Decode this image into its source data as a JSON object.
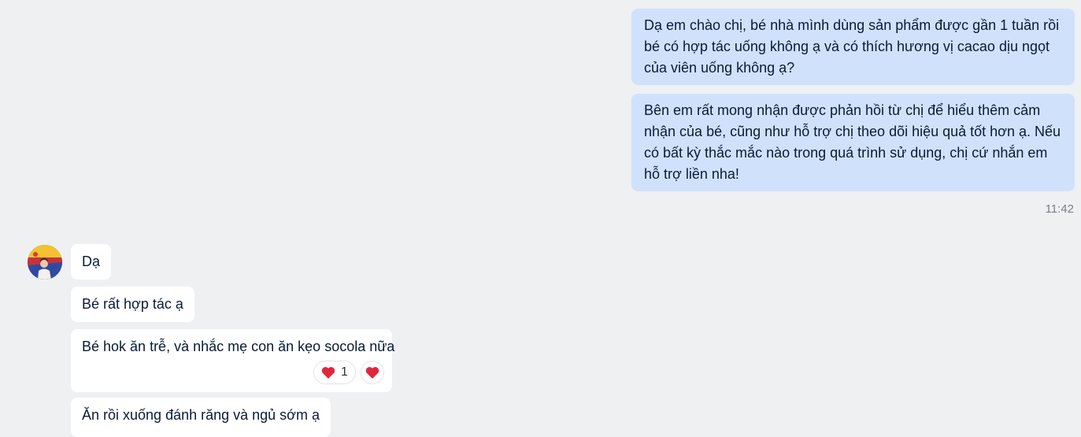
{
  "outgoing": [
    {
      "text": "Dạ em chào chị, bé nhà mình dùng sản phẩm được gần 1 tuần rồi bé có hợp tác uống không ạ và có thích hương vị cacao dịu ngọt của viên uống không ạ?"
    },
    {
      "text": "Bên em rất mong nhận được phản hồi từ chị để hiểu thêm cảm nhận của bé, cũng như hỗ trợ chị theo dõi hiệu quả tốt hơn ạ. Nếu có bất kỳ thắc mắc nào trong quá trình sử dụng, chị cứ nhắn em hỗ trợ liền nha!"
    }
  ],
  "outgoing_time": "11:42",
  "incoming": [
    {
      "text": "Dạ"
    },
    {
      "text": "Bé rất hợp tác ạ"
    },
    {
      "text": "Bé hok ăn trễ, và nhắc mẹ con ăn kẹo socola nữa"
    },
    {
      "text": "Ăn rồi xuống đánh răng và ngủ sớm ạ"
    }
  ],
  "reactions": {
    "heart_count": "1",
    "icon": "heart-icon",
    "color": "#e0263d"
  },
  "avatar": {
    "icon": "user-avatar"
  }
}
